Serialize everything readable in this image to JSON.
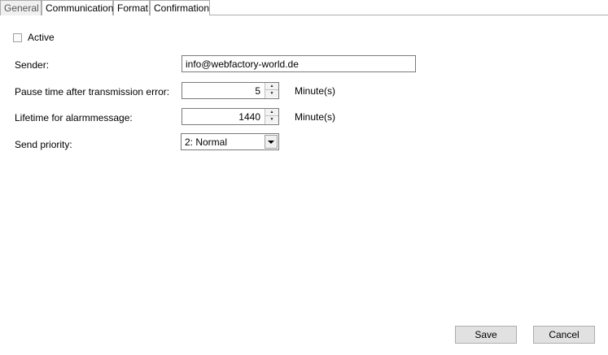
{
  "tabs": [
    {
      "label": "General",
      "active": true
    },
    {
      "label": "Communication",
      "active": false
    },
    {
      "label": "Format",
      "active": false
    },
    {
      "label": "Confirmation",
      "active": false
    }
  ],
  "general": {
    "active_label": "Active",
    "active_checked": false,
    "sender_label": "Sender:",
    "sender_value": "info@webfactory-world.de",
    "pause_label": "Pause time after transmission error:",
    "pause_value": "5",
    "pause_unit": "Minute(s)",
    "lifetime_label": "Lifetime for alarmmessage:",
    "lifetime_value": "1440",
    "lifetime_unit": "Minute(s)",
    "priority_label": "Send priority:",
    "priority_value": "2: Normal"
  },
  "buttons": {
    "save_label": "Save",
    "cancel_label": "Cancel"
  },
  "colors": {
    "background": "#ffffff",
    "active_tab_bg": "#f0f0f0",
    "button_bg": "#e1e1e1",
    "border": "#7a7a7a"
  }
}
